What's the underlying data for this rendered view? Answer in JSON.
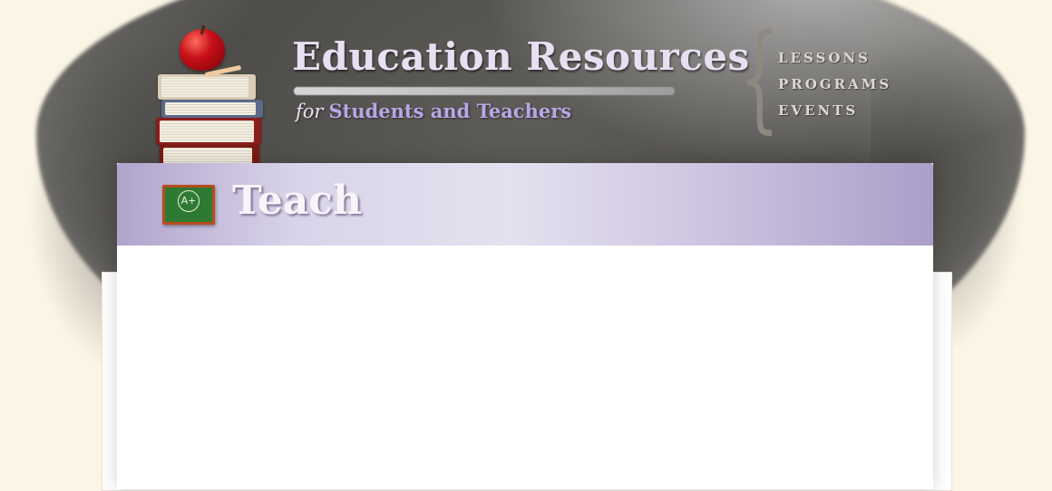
{
  "site": {
    "title": "Education Resources",
    "tagline_for": "for",
    "tagline_audience": "Students and Teachers",
    "logo": "books-and-apple-icon"
  },
  "nav": {
    "brace": "{",
    "items": [
      {
        "label": "LESSONS"
      },
      {
        "label": "PROGRAMS"
      },
      {
        "label": "EVENTS"
      }
    ]
  },
  "section": {
    "title": "Teach",
    "icon": "chalkboard-icon",
    "icon_mark": "A+"
  },
  "colors": {
    "page_background": "#fbf5e6",
    "chalkboard": "#4f4d4a",
    "title_text": "#e6e0f2",
    "tagline_accent": "#b9a6e6",
    "header_band": "#d9d4e9",
    "panel": "#ffffff"
  }
}
